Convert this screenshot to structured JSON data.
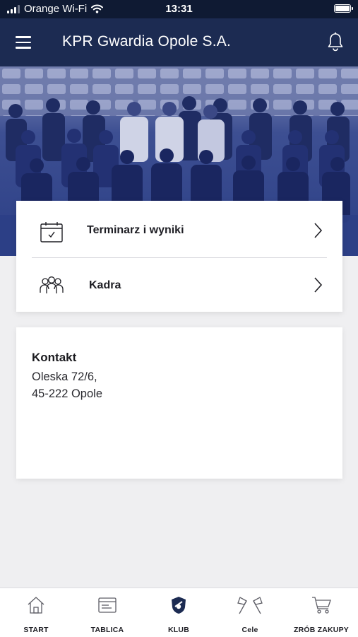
{
  "status_bar": {
    "carrier": "Orange Wi-Fi",
    "time": "13:31"
  },
  "app_bar": {
    "title": "KPR Gwardia Opole S.A."
  },
  "menu": {
    "items": [
      {
        "label": "Terminarz i wyniki",
        "icon": "calendar-check-icon"
      },
      {
        "label": "Kadra",
        "icon": "team-people-icon"
      }
    ]
  },
  "contact": {
    "title": "Kontakt",
    "address_line1": "Oleska 72/6,",
    "address_line2": "45-222 Opole"
  },
  "bottom_nav": {
    "items": [
      {
        "label": "START",
        "icon": "home-icon"
      },
      {
        "label": "TABLICA",
        "icon": "board-icon"
      },
      {
        "label": "KLUB",
        "icon": "club-crest-icon",
        "active": true
      },
      {
        "label": "Cele",
        "icon": "flags-icon"
      },
      {
        "label": "ZRÓB ZAKUPY",
        "icon": "cart-icon"
      }
    ]
  },
  "colors": {
    "app_bar": "#1c2b52",
    "hero_tint": "#2c3f86",
    "background": "#efeff1"
  }
}
